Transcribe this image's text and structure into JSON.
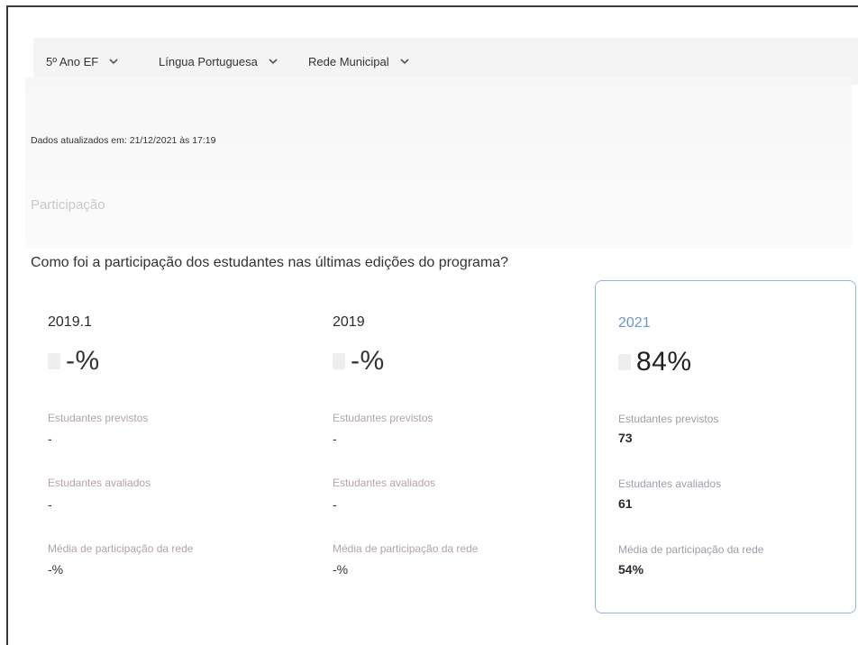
{
  "filters": [
    {
      "label": "5º Ano EF"
    },
    {
      "label": "Língua Portuguesa"
    },
    {
      "label": "Rede Municipal"
    }
  ],
  "updated_text": "Dados atualizados em: 21/12/2021 às 17:19",
  "section_title": "Participação",
  "question": "Como foi a participação dos estudantes nas últimas edições do programa?",
  "cards": [
    {
      "year": "2019.1",
      "percent": "-%",
      "previstos_label": "Estudantes previstos",
      "previstos_value": "-",
      "avaliados_label": "Estudantes avaliados",
      "avaliados_value": "-",
      "media_label": "Média de participação da rede",
      "media_value": "-%"
    },
    {
      "year": "2019",
      "percent": "-%",
      "previstos_label": "Estudantes previstos",
      "previstos_value": "-",
      "avaliados_label": "Estudantes avaliados",
      "avaliados_value": "-",
      "media_label": "Média de participação da rede",
      "media_value": "-%"
    },
    {
      "year": "2021",
      "percent": "84%",
      "previstos_label": "Estudantes previstos",
      "previstos_value": "73",
      "avaliados_label": "Estudantes avaliados",
      "avaliados_value": "61",
      "media_label": "Média de participação da rede",
      "media_value": "54%"
    }
  ],
  "colors": {
    "accent": "#6a98d2",
    "selected_border": "#8db6e8",
    "muted_label": "#b3a3a8"
  }
}
